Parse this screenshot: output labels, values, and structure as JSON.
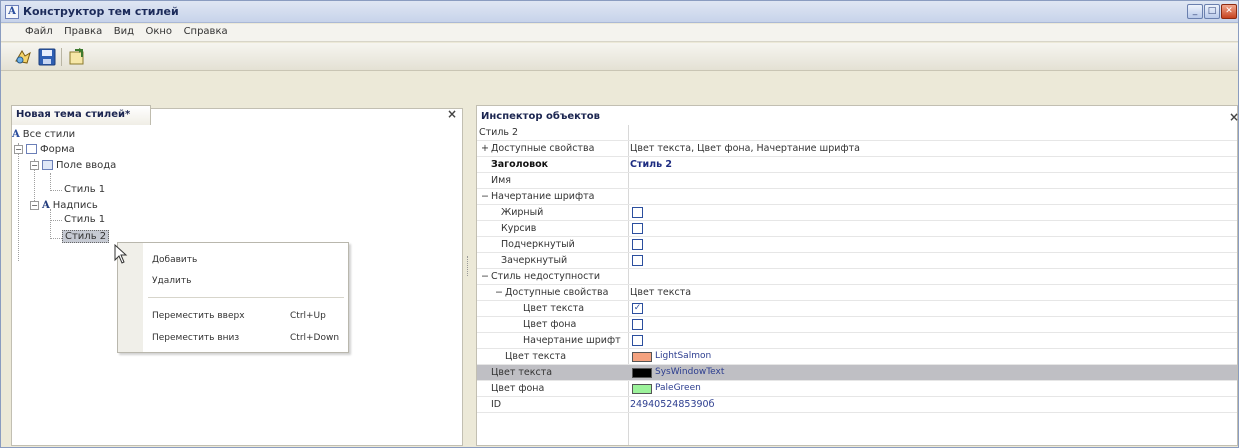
{
  "window": {
    "title": "Конструктор тем стилей",
    "app_icon_letter": "A",
    "buttons": {
      "minimize": "_",
      "maximize": "□",
      "close": "✕"
    }
  },
  "menu": [
    "Файл",
    "Правка",
    "Вид",
    "Окно",
    "Справка"
  ],
  "toolbar": {
    "icons": [
      "wizard-icon",
      "save-icon",
      "export-icon"
    ]
  },
  "left_panel": {
    "tab_title": "Новая тема стилей*",
    "close": "×",
    "tree": {
      "root": "Все стили",
      "form": "Форма",
      "input": "Поле ввода",
      "input_style1": "Стиль 1",
      "label": "Надпись",
      "label_style1": "Стиль 1",
      "label_style2": "Стиль 2"
    }
  },
  "context_menu": {
    "add": "Добавить",
    "delete": "Удалить",
    "move_up": "Переместить вверх",
    "move_up_shortcut": "Ctrl+Up",
    "move_down": "Переместить вниз",
    "move_down_shortcut": "Ctrl+Down"
  },
  "inspector": {
    "title": "Инспектор объектов",
    "close": "×",
    "rows": {
      "style": "Стиль 2",
      "available_props": "Доступные свойства",
      "available_props_value": "Цвет текста, Цвет фона, Начертание шрифта",
      "caption": "Заголовок",
      "caption_value": "Стиль 2",
      "name": "Имя",
      "font_style": "Начертание шрифта",
      "bold": "Жирный",
      "italic": "Курсив",
      "underline": "Подчеркнутый",
      "strikeout": "Зачеркнутый",
      "disabled_style": "Стиль недоступности",
      "disabled_available": "Доступные свойства",
      "disabled_available_value": "Цвет текста",
      "text_color_chk": "Цвет текста",
      "bg_color_chk": "Цвет фона",
      "font_chk": "Начертание шрифт",
      "disabled_text_color": "Цвет текста",
      "disabled_text_color_value": "LightSalmon",
      "text_color": "Цвет текста",
      "text_color_value": "SysWindowText",
      "bg_color": "Цвет фона",
      "bg_color_value": "PaleGreen",
      "id": "ID",
      "id_value": "2494052485390б"
    }
  },
  "colors": {
    "light_salmon": "#f4a27f",
    "sys_window_text": "#000000",
    "pale_green": "#9cf29a"
  }
}
